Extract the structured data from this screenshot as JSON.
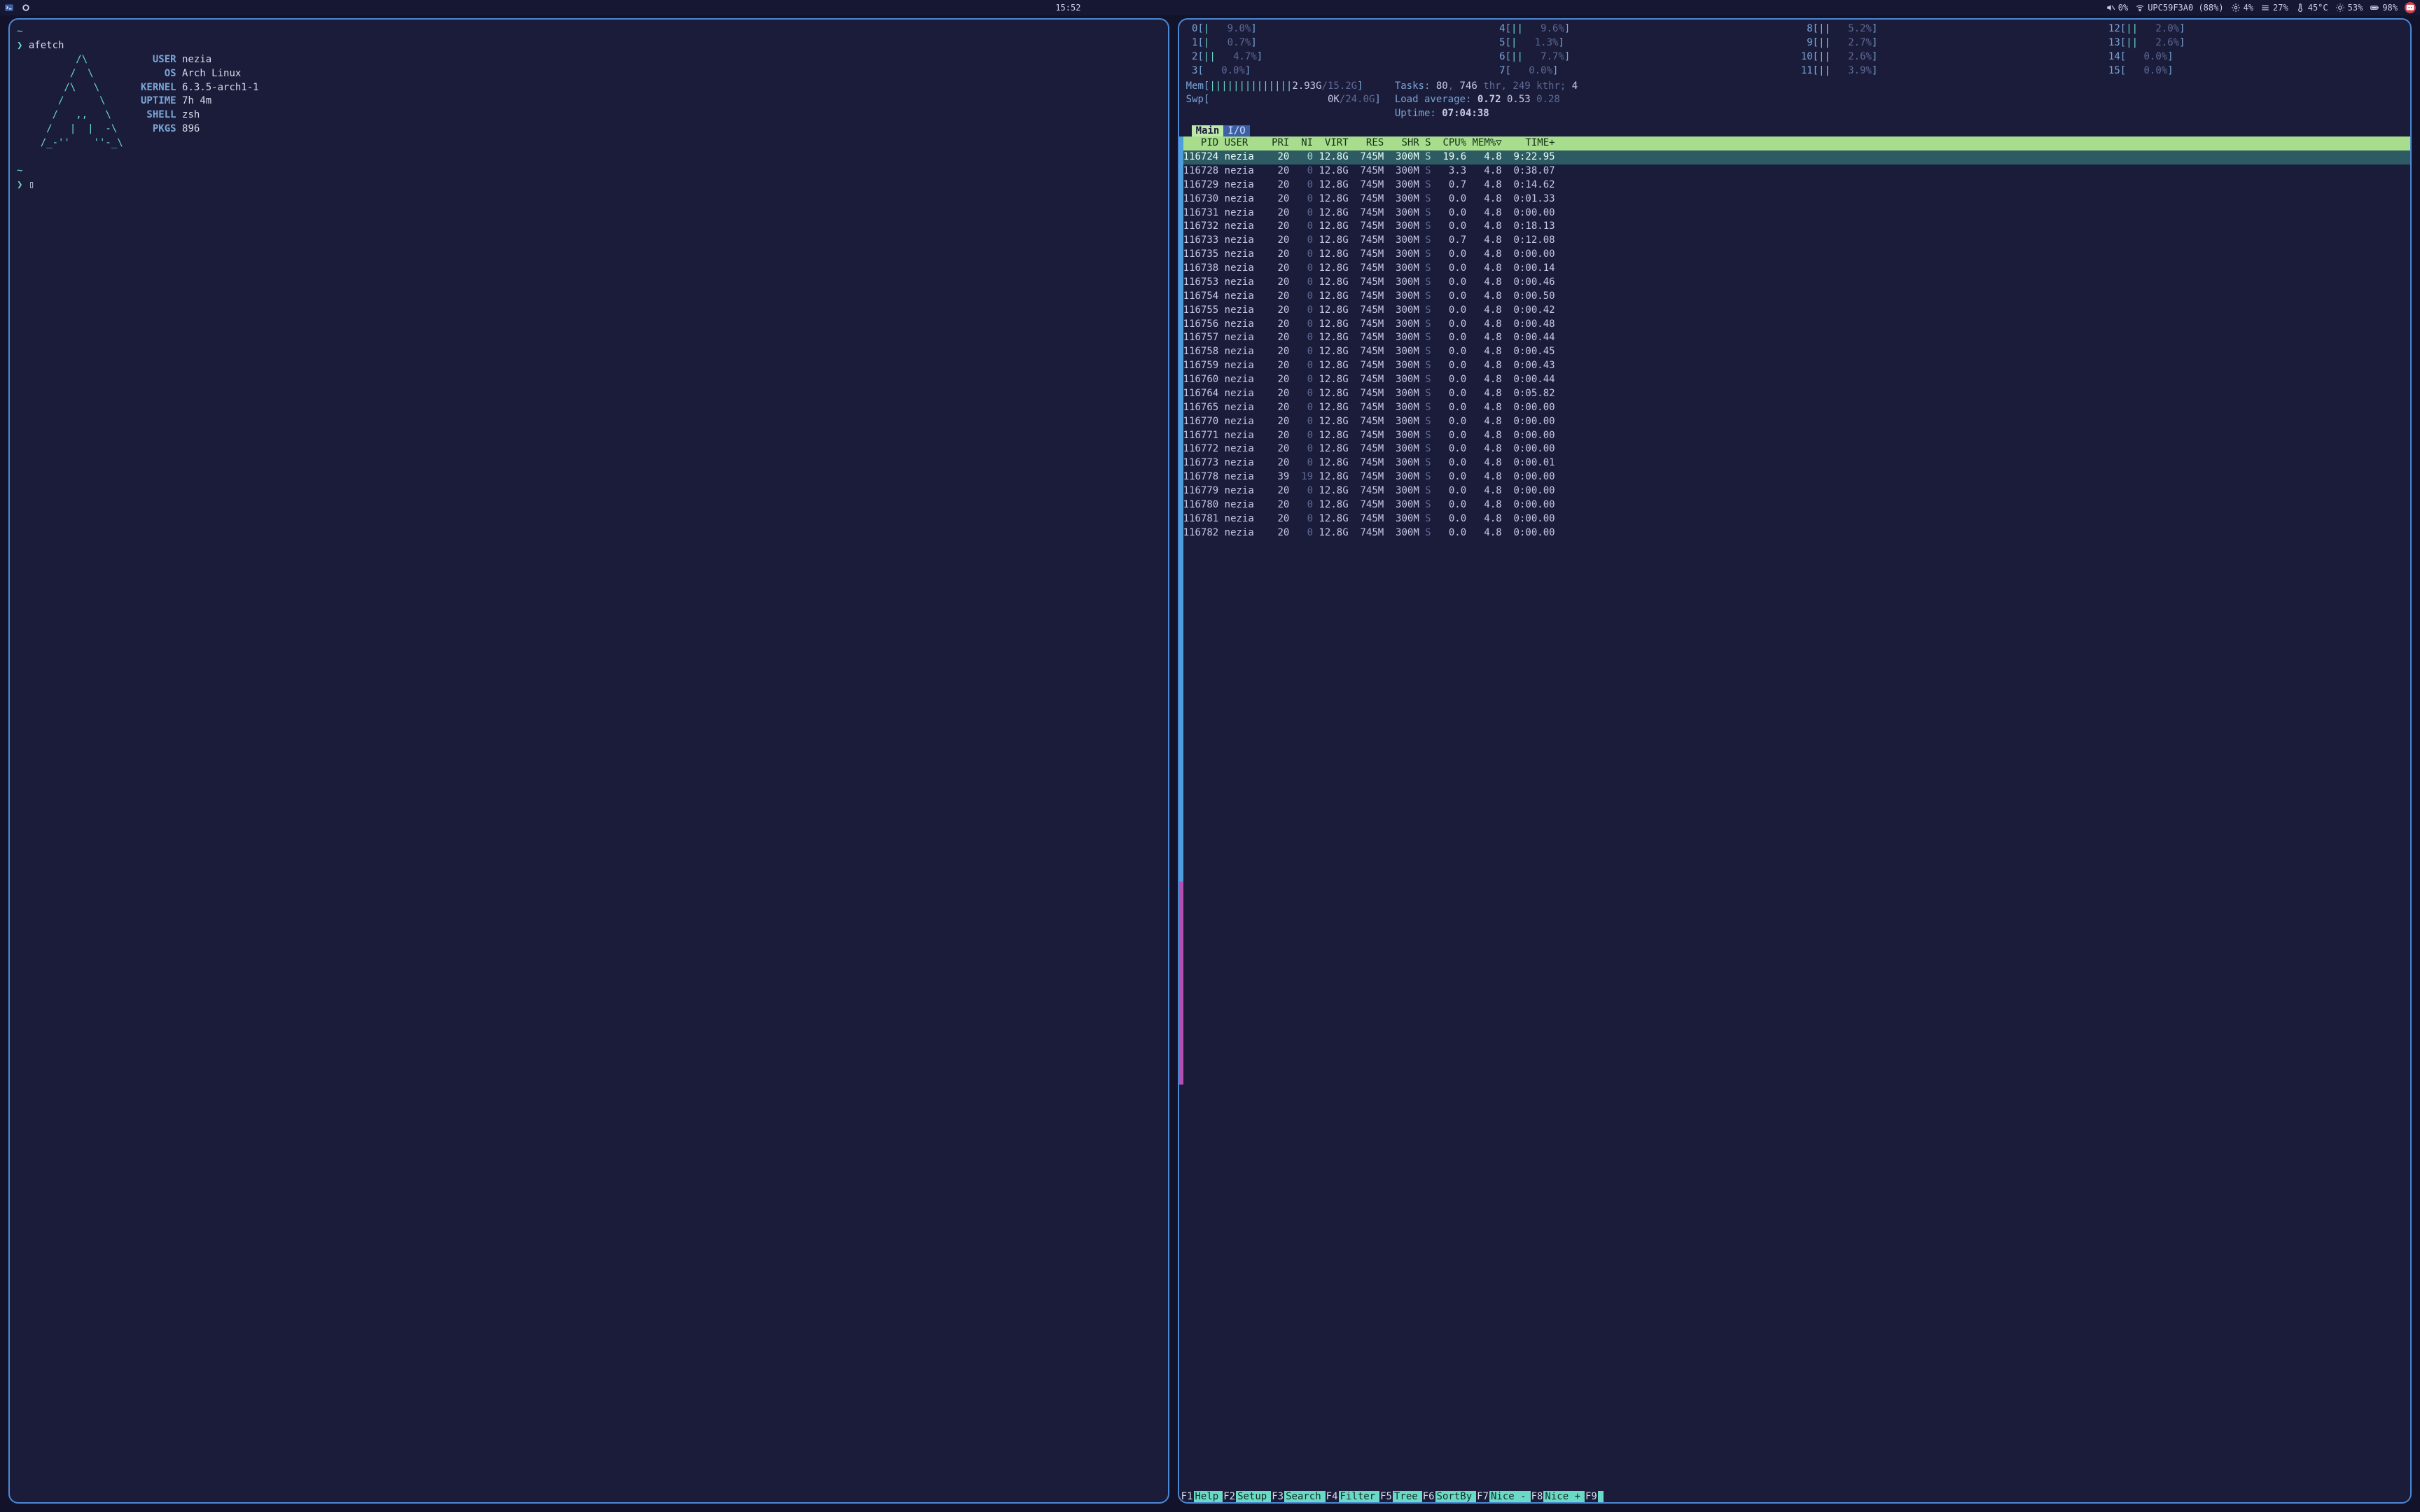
{
  "topbar": {
    "clock": "15:52",
    "volume_pct": "0%",
    "wifi": "UPC59F3A0 (88%)",
    "gear_pct": "4%",
    "menu_pct": "27%",
    "temp": "45°C",
    "brightness_pct": "53%",
    "battery_pct": "98%"
  },
  "afetch": {
    "cmd": "afetch",
    "ascii": [
      "~",
      "",
      "          /\\",
      "         /  \\",
      "        /\\   \\",
      "       /      \\",
      "      /   ,,   \\",
      "     /   |  |  -\\",
      "    /_-''    ''-_\\",
      "",
      "~"
    ],
    "fields": [
      {
        "label": "USER",
        "value": "nezia"
      },
      {
        "label": "OS",
        "value": "Arch Linux"
      },
      {
        "label": "KERNEL",
        "value": "6.3.5-arch1-1"
      },
      {
        "label": "UPTIME",
        "value": "7h 4m"
      },
      {
        "label": "SHELL",
        "value": "zsh"
      },
      {
        "label": "PKGS",
        "value": "896"
      }
    ],
    "prompt_glyph": "❯",
    "cursor": "▯"
  },
  "htop": {
    "cpus": [
      {
        "n": 0,
        "bar": "|",
        "pct": "9.0%"
      },
      {
        "n": 1,
        "bar": "|",
        "pct": "0.7%"
      },
      {
        "n": 2,
        "bar": "||",
        "pct": "4.7%"
      },
      {
        "n": 3,
        "bar": "",
        "pct": "0.0%"
      },
      {
        "n": 4,
        "bar": "||",
        "pct": "9.6%"
      },
      {
        "n": 5,
        "bar": "|",
        "pct": "1.3%"
      },
      {
        "n": 6,
        "bar": "||",
        "pct": "7.7%"
      },
      {
        "n": 7,
        "bar": "",
        "pct": "0.0%"
      },
      {
        "n": 8,
        "bar": "||",
        "pct": "5.2%"
      },
      {
        "n": 9,
        "bar": "||",
        "pct": "2.7%"
      },
      {
        "n": 10,
        "bar": "||",
        "pct": "2.6%"
      },
      {
        "n": 11,
        "bar": "||",
        "pct": "3.9%"
      },
      {
        "n": 12,
        "bar": "||",
        "pct": "2.0%"
      },
      {
        "n": 13,
        "bar": "||",
        "pct": "2.6%"
      },
      {
        "n": 14,
        "bar": "",
        "pct": "0.0%"
      },
      {
        "n": 15,
        "bar": "",
        "pct": "0.0%"
      }
    ],
    "mem": {
      "label": "Mem",
      "bar": "||||||||||||||",
      "used": "2.93G",
      "total": "15.2G"
    },
    "swp": {
      "label": "Swp",
      "bar": "",
      "used": "0K",
      "total": "24.0G"
    },
    "tasks": {
      "procs": "80",
      "threads": "746",
      "kthr": "249",
      "running": "4"
    },
    "load": {
      "l1": "0.72",
      "l5": "0.53",
      "l15": "0.28"
    },
    "uptime": "07:04:38",
    "tabs": {
      "active": "Main",
      "inactive": "I/O"
    },
    "columns": [
      "PID",
      "USER",
      "PRI",
      "NI",
      "VIRT",
      "RES",
      "SHR",
      "S",
      "CPU%",
      "MEM%▽",
      "TIME+"
    ],
    "processes": [
      {
        "pid": "116724",
        "user": "nezia",
        "pri": "20",
        "ni": "0",
        "virt": "12.8G",
        "res": "745M",
        "shr": "300M",
        "s": "S",
        "cpu": "19.6",
        "mem": "4.8",
        "time": "9:22.95",
        "sel": true
      },
      {
        "pid": "116728",
        "user": "nezia",
        "pri": "20",
        "ni": "0",
        "virt": "12.8G",
        "res": "745M",
        "shr": "300M",
        "s": "S",
        "cpu": "3.3",
        "mem": "4.8",
        "time": "0:38.07"
      },
      {
        "pid": "116729",
        "user": "nezia",
        "pri": "20",
        "ni": "0",
        "virt": "12.8G",
        "res": "745M",
        "shr": "300M",
        "s": "S",
        "cpu": "0.7",
        "mem": "4.8",
        "time": "0:14.62"
      },
      {
        "pid": "116730",
        "user": "nezia",
        "pri": "20",
        "ni": "0",
        "virt": "12.8G",
        "res": "745M",
        "shr": "300M",
        "s": "S",
        "cpu": "0.0",
        "mem": "4.8",
        "time": "0:01.33"
      },
      {
        "pid": "116731",
        "user": "nezia",
        "pri": "20",
        "ni": "0",
        "virt": "12.8G",
        "res": "745M",
        "shr": "300M",
        "s": "S",
        "cpu": "0.0",
        "mem": "4.8",
        "time": "0:00.00"
      },
      {
        "pid": "116732",
        "user": "nezia",
        "pri": "20",
        "ni": "0",
        "virt": "12.8G",
        "res": "745M",
        "shr": "300M",
        "s": "S",
        "cpu": "0.0",
        "mem": "4.8",
        "time": "0:18.13"
      },
      {
        "pid": "116733",
        "user": "nezia",
        "pri": "20",
        "ni": "0",
        "virt": "12.8G",
        "res": "745M",
        "shr": "300M",
        "s": "S",
        "cpu": "0.7",
        "mem": "4.8",
        "time": "0:12.08"
      },
      {
        "pid": "116735",
        "user": "nezia",
        "pri": "20",
        "ni": "0",
        "virt": "12.8G",
        "res": "745M",
        "shr": "300M",
        "s": "S",
        "cpu": "0.0",
        "mem": "4.8",
        "time": "0:00.00"
      },
      {
        "pid": "116738",
        "user": "nezia",
        "pri": "20",
        "ni": "0",
        "virt": "12.8G",
        "res": "745M",
        "shr": "300M",
        "s": "S",
        "cpu": "0.0",
        "mem": "4.8",
        "time": "0:00.14"
      },
      {
        "pid": "116753",
        "user": "nezia",
        "pri": "20",
        "ni": "0",
        "virt": "12.8G",
        "res": "745M",
        "shr": "300M",
        "s": "S",
        "cpu": "0.0",
        "mem": "4.8",
        "time": "0:00.46"
      },
      {
        "pid": "116754",
        "user": "nezia",
        "pri": "20",
        "ni": "0",
        "virt": "12.8G",
        "res": "745M",
        "shr": "300M",
        "s": "S",
        "cpu": "0.0",
        "mem": "4.8",
        "time": "0:00.50"
      },
      {
        "pid": "116755",
        "user": "nezia",
        "pri": "20",
        "ni": "0",
        "virt": "12.8G",
        "res": "745M",
        "shr": "300M",
        "s": "S",
        "cpu": "0.0",
        "mem": "4.8",
        "time": "0:00.42"
      },
      {
        "pid": "116756",
        "user": "nezia",
        "pri": "20",
        "ni": "0",
        "virt": "12.8G",
        "res": "745M",
        "shr": "300M",
        "s": "S",
        "cpu": "0.0",
        "mem": "4.8",
        "time": "0:00.48"
      },
      {
        "pid": "116757",
        "user": "nezia",
        "pri": "20",
        "ni": "0",
        "virt": "12.8G",
        "res": "745M",
        "shr": "300M",
        "s": "S",
        "cpu": "0.0",
        "mem": "4.8",
        "time": "0:00.44"
      },
      {
        "pid": "116758",
        "user": "nezia",
        "pri": "20",
        "ni": "0",
        "virt": "12.8G",
        "res": "745M",
        "shr": "300M",
        "s": "S",
        "cpu": "0.0",
        "mem": "4.8",
        "time": "0:00.45"
      },
      {
        "pid": "116759",
        "user": "nezia",
        "pri": "20",
        "ni": "0",
        "virt": "12.8G",
        "res": "745M",
        "shr": "300M",
        "s": "S",
        "cpu": "0.0",
        "mem": "4.8",
        "time": "0:00.43"
      },
      {
        "pid": "116760",
        "user": "nezia",
        "pri": "20",
        "ni": "0",
        "virt": "12.8G",
        "res": "745M",
        "shr": "300M",
        "s": "S",
        "cpu": "0.0",
        "mem": "4.8",
        "time": "0:00.44"
      },
      {
        "pid": "116764",
        "user": "nezia",
        "pri": "20",
        "ni": "0",
        "virt": "12.8G",
        "res": "745M",
        "shr": "300M",
        "s": "S",
        "cpu": "0.0",
        "mem": "4.8",
        "time": "0:05.82"
      },
      {
        "pid": "116765",
        "user": "nezia",
        "pri": "20",
        "ni": "0",
        "virt": "12.8G",
        "res": "745M",
        "shr": "300M",
        "s": "S",
        "cpu": "0.0",
        "mem": "4.8",
        "time": "0:00.00"
      },
      {
        "pid": "116770",
        "user": "nezia",
        "pri": "20",
        "ni": "0",
        "virt": "12.8G",
        "res": "745M",
        "shr": "300M",
        "s": "S",
        "cpu": "0.0",
        "mem": "4.8",
        "time": "0:00.00"
      },
      {
        "pid": "116771",
        "user": "nezia",
        "pri": "20",
        "ni": "0",
        "virt": "12.8G",
        "res": "745M",
        "shr": "300M",
        "s": "S",
        "cpu": "0.0",
        "mem": "4.8",
        "time": "0:00.00"
      },
      {
        "pid": "116772",
        "user": "nezia",
        "pri": "20",
        "ni": "0",
        "virt": "12.8G",
        "res": "745M",
        "shr": "300M",
        "s": "S",
        "cpu": "0.0",
        "mem": "4.8",
        "time": "0:00.00"
      },
      {
        "pid": "116773",
        "user": "nezia",
        "pri": "20",
        "ni": "0",
        "virt": "12.8G",
        "res": "745M",
        "shr": "300M",
        "s": "S",
        "cpu": "0.0",
        "mem": "4.8",
        "time": "0:00.01"
      },
      {
        "pid": "116778",
        "user": "nezia",
        "pri": "39",
        "ni": "19",
        "virt": "12.8G",
        "res": "745M",
        "shr": "300M",
        "s": "S",
        "cpu": "0.0",
        "mem": "4.8",
        "time": "0:00.00"
      },
      {
        "pid": "116779",
        "user": "nezia",
        "pri": "20",
        "ni": "0",
        "virt": "12.8G",
        "res": "745M",
        "shr": "300M",
        "s": "S",
        "cpu": "0.0",
        "mem": "4.8",
        "time": "0:00.00"
      },
      {
        "pid": "116780",
        "user": "nezia",
        "pri": "20",
        "ni": "0",
        "virt": "12.8G",
        "res": "745M",
        "shr": "300M",
        "s": "S",
        "cpu": "0.0",
        "mem": "4.8",
        "time": "0:00.00"
      },
      {
        "pid": "116781",
        "user": "nezia",
        "pri": "20",
        "ni": "0",
        "virt": "12.8G",
        "res": "745M",
        "shr": "300M",
        "s": "S",
        "cpu": "0.0",
        "mem": "4.8",
        "time": "0:00.00"
      },
      {
        "pid": "116782",
        "user": "nezia",
        "pri": "20",
        "ni": "0",
        "virt": "12.8G",
        "res": "745M",
        "shr": "300M",
        "s": "S",
        "cpu": "0.0",
        "mem": "4.8",
        "time": "0:00.00"
      }
    ],
    "fnkeys": [
      {
        "k": "F1",
        "lbl": "Help  "
      },
      {
        "k": "F2",
        "lbl": "Setup "
      },
      {
        "k": "F3",
        "lbl": "Search"
      },
      {
        "k": "F4",
        "lbl": "Filter"
      },
      {
        "k": "F5",
        "lbl": "Tree  "
      },
      {
        "k": "F6",
        "lbl": "SortBy"
      },
      {
        "k": "F7",
        "lbl": "Nice -"
      },
      {
        "k": "F8",
        "lbl": "Nice +"
      },
      {
        "k": "F9",
        "lbl": ""
      }
    ]
  }
}
